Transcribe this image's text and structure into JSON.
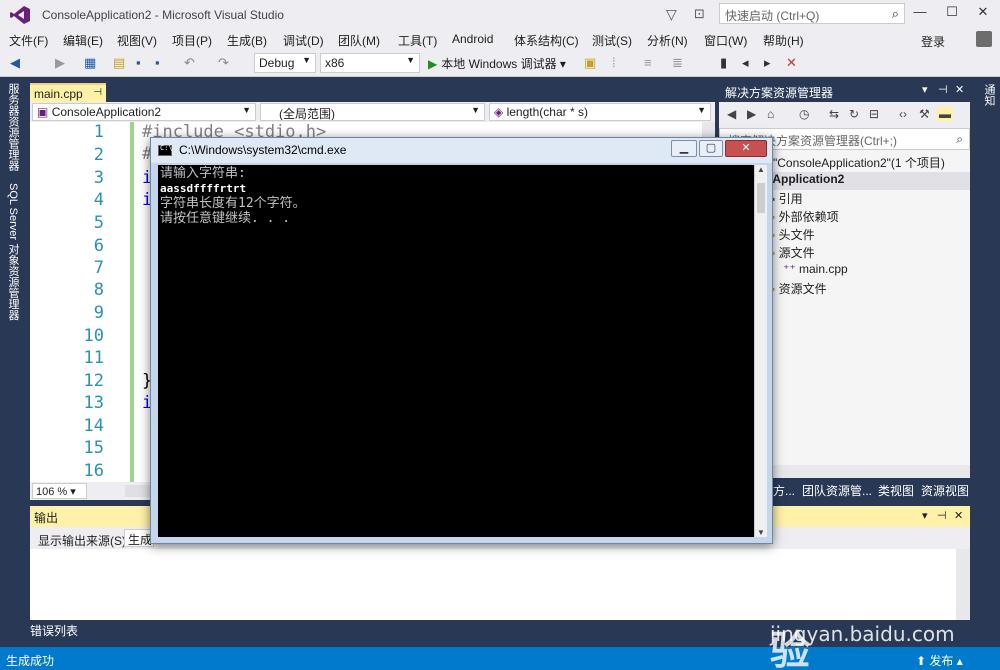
{
  "window": {
    "title": "ConsoleApplication2 - Microsoft Visual Studio"
  },
  "quick_launch": {
    "placeholder": "快速启动 (Ctrl+Q)"
  },
  "menu": [
    "文件(F)",
    "编辑(E)",
    "视图(V)",
    "项目(P)",
    "生成(B)",
    "调试(D)",
    "团队(M)",
    "工具(T)",
    "Android",
    "体系结构(C)",
    "测试(S)",
    "分析(N)",
    "窗口(W)",
    "帮助(H)"
  ],
  "login": "登录",
  "toolbar": {
    "config": "Debug",
    "platform": "x86",
    "run": "本地 Windows 调试器"
  },
  "left_tabs": [
    "服务器资源管理器",
    "SQL Server 对象资源管理器"
  ],
  "editor": {
    "tab": "main.cpp",
    "nav_project": "ConsoleApplication2",
    "nav_scope": "(全局范围)",
    "nav_member": "length(char * s)",
    "zoom": "106 %",
    "line_numbers": [
      "1",
      "2",
      "3",
      "4",
      "5",
      "6",
      "7",
      "8",
      "9",
      "10",
      "11",
      "12",
      "13",
      "14",
      "15",
      "16"
    ],
    "first_line": "#include <stdio.h>"
  },
  "solution_explorer": {
    "title": "解决方案资源管理器",
    "search_placeholder": "搜索解决方案资源管理器(Ctrl+;)",
    "solution": "解决方案\"ConsoleApplication2\"(1 个项目)",
    "project": "ConsoleApplication2",
    "items": [
      "引用",
      "外部依赖项",
      "头文件",
      "源文件",
      "main.cpp",
      "资源文件"
    ],
    "tabs": [
      "解决方...",
      "团队资源管...",
      "类视图",
      "资源视图"
    ]
  },
  "right_tab": "通知",
  "output": {
    "title": "输出",
    "source_label": "显示输出来源(S):",
    "source_value": "生成"
  },
  "error_list_tab": "错误列表",
  "status": {
    "text": "生成成功",
    "publish": "发布"
  },
  "cmd": {
    "title": "C:\\Windows\\system32\\cmd.exe",
    "lines": [
      "请输入字符串:",
      "aassdffffrtrt",
      "字符串长度有12个字符。",
      "请按任意键继续. . ."
    ]
  },
  "watermark": {
    "logo": "Baidu经验",
    "url": "jingyan.baidu.com"
  }
}
